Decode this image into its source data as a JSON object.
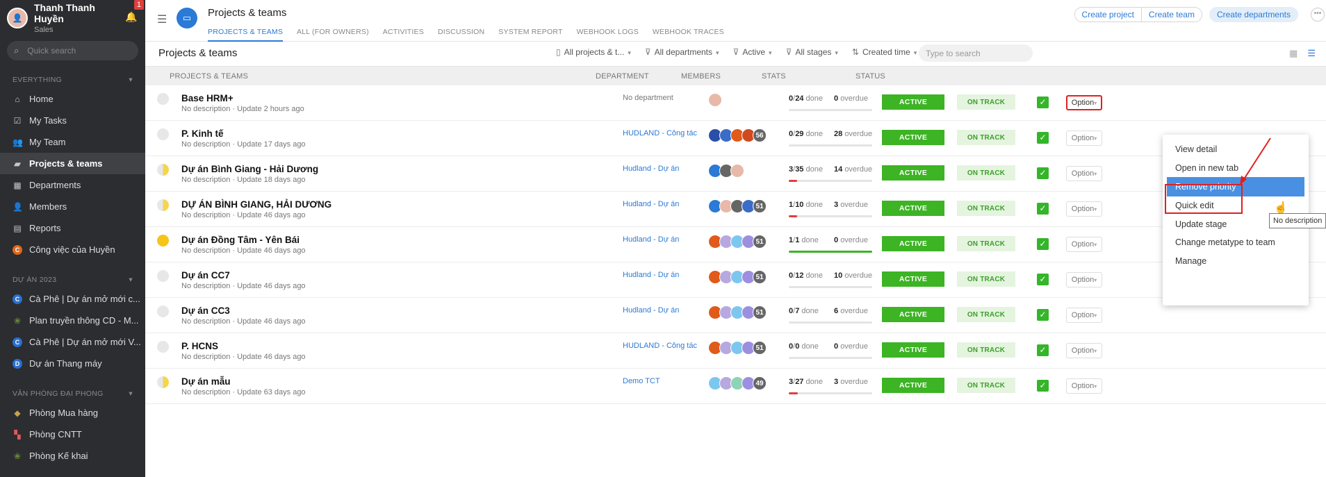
{
  "user": {
    "name": "Thanh Thanh Huyền",
    "role": "Sales",
    "notif_count": "1"
  },
  "sidebar": {
    "search_placeholder": "Quick search",
    "section_everything": "EVERYTHING",
    "items": [
      {
        "label": "Home",
        "icon": "home-icon"
      },
      {
        "label": "My Tasks",
        "icon": "task-icon"
      },
      {
        "label": "My Team",
        "icon": "team-icon"
      },
      {
        "label": "Projects & teams",
        "icon": "folder-icon"
      },
      {
        "label": "Departments",
        "icon": "department-icon"
      },
      {
        "label": "Members",
        "icon": "members-icon"
      },
      {
        "label": "Reports",
        "icon": "reports-icon"
      },
      {
        "label": "Công việc của Huyền",
        "icon": "c-badge-icon"
      }
    ],
    "section_du_an": "DỰ ÁN 2023",
    "du_an_items": [
      {
        "label": "Cà Phê | Dự án mở mới c...",
        "badge": "C",
        "color": "#2a6fd1"
      },
      {
        "label": "Plan truyền thông CD - M...",
        "badge": "",
        "color": "#6a8a3a"
      },
      {
        "label": "Cà Phê | Dự án mở mới V...",
        "badge": "C",
        "color": "#2a6fd1"
      },
      {
        "label": "Dự án Thang máy",
        "badge": "D",
        "color": "#2a6fd1"
      }
    ],
    "section_van_phong": "VĂN PHÒNG ĐẠI PHONG",
    "van_phong_items": [
      {
        "label": "Phòng Mua hàng"
      },
      {
        "label": "Phòng CNTT"
      },
      {
        "label": "Phòng Kế khai"
      }
    ]
  },
  "header": {
    "title": "Projects & teams",
    "tabs": [
      "PROJECTS & TEAMS",
      "ALL (FOR OWNERS)",
      "ACTIVITIES",
      "DISCUSSION",
      "SYSTEM REPORT",
      "WEBHOOK LOGS",
      "WEBHOOK TRACES"
    ],
    "create_project": "Create project",
    "create_team": "Create team",
    "create_departments": "Create departments"
  },
  "toolbar": {
    "title": "Projects & teams",
    "filters": [
      "All projects & t...",
      "All departments",
      "Active",
      "All stages",
      "Created time"
    ],
    "search_placeholder": "Type to search"
  },
  "columns": {
    "projects": "PROJECTS & TEAMS",
    "department": "DEPARTMENT",
    "members": "MEMBERS",
    "stats": "STATS",
    "status": "STATUS"
  },
  "rows": [
    {
      "name": "Base HRM+",
      "sub": "No description · Update 2 hours ago",
      "dept": "No department",
      "dot": "empty",
      "members": [
        "#e8b9a8"
      ],
      "count": "",
      "done": "0",
      "total": "24",
      "overdue": "0",
      "progress": 0,
      "bar": "#e4e4e4",
      "status": "ACTIVE",
      "track": "ON TRACK",
      "option": "Option"
    },
    {
      "name": "P. Kinh tế",
      "sub": "No description · Update 17 days ago",
      "dept": "HUDLAND - Công tác nội",
      "dot": "empty",
      "members": [
        "#2b4fa8",
        "#3a6cc8",
        "#e05a1a",
        "#d04a20"
      ],
      "count": "56",
      "done": "0",
      "total": "29",
      "overdue": "28",
      "progress": 0,
      "bar": "#e4e4e4",
      "status": "ACTIVE",
      "track": "ON TRACK",
      "option": "Option"
    },
    {
      "name": "Dự án Bình Giang - Hải Dương",
      "sub": "No description · Update 18 days ago",
      "dept": "Hudland - Dự án",
      "dot": "half",
      "members": [
        "#2a7ad6",
        "#666",
        "#e8b9a8"
      ],
      "count": "",
      "done": "3",
      "total": "35",
      "overdue": "14",
      "progress": 0.086,
      "bar": "#e03e3e",
      "status": "ACTIVE",
      "track": "ON TRACK",
      "option": "Option"
    },
    {
      "name": "DỰ ÁN BÌNH GIANG, HẢI DƯƠNG",
      "sub": "No description · Update 46 days ago",
      "dept": "Hudland - Dự án",
      "dot": "half",
      "members": [
        "#2a7ad6",
        "#e8b9a8",
        "#666",
        "#3a6cc8"
      ],
      "count": "51",
      "done": "1",
      "total": "10",
      "overdue": "3",
      "progress": 0.1,
      "bar": "#e03e3e",
      "status": "ACTIVE",
      "track": "ON TRACK",
      "option": "Option"
    },
    {
      "name": "Dự án Đồng Tâm - Yên Bái",
      "sub": "No description · Update 46 days ago",
      "dept": "Hudland - Dự án",
      "dot": "full",
      "members": [
        "#e05a1a",
        "#b7a8e0",
        "#7dc7ef",
        "#9d8fe0"
      ],
      "count": "51",
      "done": "1",
      "total": "1",
      "overdue": "0",
      "progress": 1,
      "bar": "#3cb424",
      "status": "ACTIVE",
      "track": "ON TRACK",
      "option": "Option"
    },
    {
      "name": "Dự án CC7",
      "sub": "No description · Update 46 days ago",
      "dept": "Hudland - Dự án",
      "dot": "empty",
      "members": [
        "#e05a1a",
        "#b7a8e0",
        "#7dc7ef",
        "#9d8fe0"
      ],
      "count": "51",
      "done": "0",
      "total": "12",
      "overdue": "10",
      "progress": 0,
      "bar": "#e4e4e4",
      "status": "ACTIVE",
      "track": "ON TRACK",
      "option": "Option"
    },
    {
      "name": "Dự án CC3",
      "sub": "No description · Update 46 days ago",
      "dept": "Hudland - Dự án",
      "dot": "empty",
      "members": [
        "#e05a1a",
        "#b7a8e0",
        "#7dc7ef",
        "#9d8fe0"
      ],
      "count": "51",
      "done": "0",
      "total": "7",
      "overdue": "6",
      "progress": 0,
      "bar": "#e4e4e4",
      "status": "ACTIVE",
      "track": "ON TRACK",
      "option": "Option"
    },
    {
      "name": "P. HCNS",
      "sub": "No description · Update 46 days ago",
      "dept": "HUDLAND - Công tác nội",
      "dot": "empty",
      "members": [
        "#e05a1a",
        "#b7a8e0",
        "#7dc7ef",
        "#9d8fe0"
      ],
      "count": "51",
      "done": "0",
      "total": "0",
      "overdue": "0",
      "progress": 0,
      "bar": "#e4e4e4",
      "status": "ACTIVE",
      "track": "ON TRACK",
      "option": "Option"
    },
    {
      "name": "Dự án mẫu",
      "sub": "No description · Update 63 days ago",
      "dept": "Demo TCT",
      "dot": "half",
      "members": [
        "#7dc7ef",
        "#b7a8e0",
        "#8ed3b6",
        "#9d8fe0"
      ],
      "count": "49",
      "done": "3",
      "total": "27",
      "overdue": "3",
      "progress": 0.11,
      "bar": "#e03e3e",
      "status": "ACTIVE",
      "track": "ON TRACK",
      "option": "Option"
    }
  ],
  "labels": {
    "done": "done",
    "overdue": "overdue"
  },
  "menu": {
    "items": [
      "View detail",
      "Open in new tab",
      "Remove priority",
      "Quick edit",
      "Update stage",
      "Change metatype to team",
      "Manage"
    ],
    "selected_index": 2
  },
  "tooltip": "No description",
  "colors": {
    "accent": "#2a7ad6",
    "active_green": "#3cb424",
    "highlight_red": "#e02020"
  }
}
